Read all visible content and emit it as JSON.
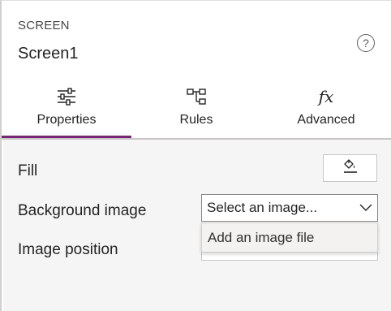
{
  "header": {
    "kind": "SCREEN",
    "title": "Screen1",
    "help_icon": "question-circle-icon",
    "help_glyph": "?"
  },
  "tabs": [
    {
      "label": "Properties",
      "icon": "sliders-icon",
      "active": true
    },
    {
      "label": "Rules",
      "icon": "rules-icon",
      "active": false
    },
    {
      "label": "Advanced",
      "icon": "fx-icon",
      "active": false,
      "glyph": "fx"
    }
  ],
  "properties": {
    "fill_label": "Fill",
    "fill_icon": "paint-bucket-icon",
    "background_image_label": "Background image",
    "background_image_value": "Select an image...",
    "image_position_label": "Image position"
  },
  "dropdown": {
    "items": [
      {
        "label": "Add an image file"
      }
    ]
  },
  "colors": {
    "accent": "#742774",
    "panel_bg": "#f5f5f5"
  }
}
